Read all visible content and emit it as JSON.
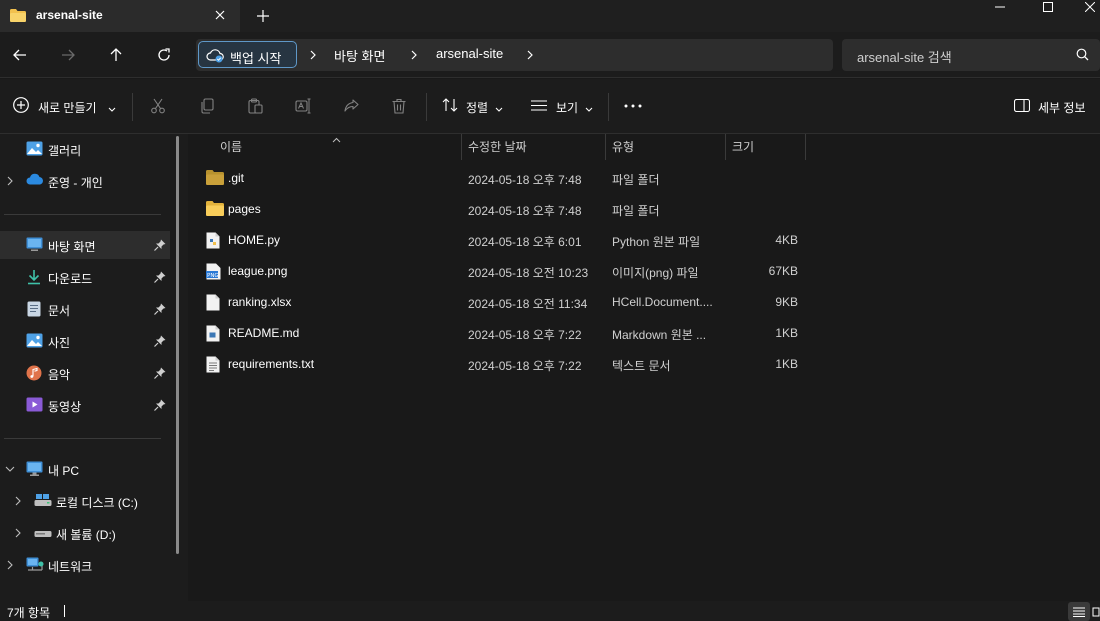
{
  "tab": {
    "title": "arsenal-site"
  },
  "address": {
    "backup_label": "백업 시작",
    "crumbs": [
      "바탕 화면",
      "arsenal-site"
    ]
  },
  "search": {
    "placeholder": "arsenal-site 검색"
  },
  "commands": {
    "new_label": "새로 만들기",
    "sort_label": "정렬",
    "view_label": "보기",
    "details_label": "세부 정보"
  },
  "sidebar": {
    "items": [
      {
        "label": "갤러리",
        "icon": "gallery-icon"
      },
      {
        "label": "준영 - 개인",
        "icon": "onedrive-cloud-icon"
      },
      {
        "label": "바탕 화면",
        "icon": "desktop-icon"
      },
      {
        "label": "다운로드",
        "icon": "download-icon"
      },
      {
        "label": "문서",
        "icon": "document-icon"
      },
      {
        "label": "사진",
        "icon": "pictures-icon"
      },
      {
        "label": "음악",
        "icon": "music-icon"
      },
      {
        "label": "동영상",
        "icon": "video-icon"
      },
      {
        "label": "내 PC",
        "icon": "pc-icon"
      },
      {
        "label": "로컬 디스크 (C:)",
        "icon": "drive-icon"
      },
      {
        "label": "새 볼륨 (D:)",
        "icon": "drive-icon"
      },
      {
        "label": "네트워크",
        "icon": "network-icon"
      }
    ]
  },
  "columns": {
    "name": "이름",
    "date": "수정한 날짜",
    "type": "유형",
    "size": "크기"
  },
  "files": [
    {
      "name": ".git",
      "date": "2024-05-18 오후 7:48",
      "type": "파일 폴더",
      "size": "",
      "icon": "folder-icon"
    },
    {
      "name": "pages",
      "date": "2024-05-18 오후 7:48",
      "type": "파일 폴더",
      "size": "",
      "icon": "folder-icon"
    },
    {
      "name": "HOME.py",
      "date": "2024-05-18 오후 6:01",
      "type": "Python 원본 파일",
      "size": "4KB",
      "icon": "python-file-icon"
    },
    {
      "name": "league.png",
      "date": "2024-05-18 오전 10:23",
      "type": "이미지(png) 파일",
      "size": "67KB",
      "icon": "image-file-icon"
    },
    {
      "name": "ranking.xlsx",
      "date": "2024-05-18 오전 11:34",
      "type": "HCell.Document....",
      "size": "9KB",
      "icon": "file-icon"
    },
    {
      "name": "README.md",
      "date": "2024-05-18 오후 7:22",
      "type": "Markdown 원본 ...",
      "size": "1KB",
      "icon": "markdown-file-icon"
    },
    {
      "name": "requirements.txt",
      "date": "2024-05-18 오후 7:22",
      "type": "텍스트 문서",
      "size": "1KB",
      "icon": "text-file-icon"
    }
  ],
  "status": {
    "count": "7개 항목"
  },
  "colors": {
    "accent": "#4ea1e6",
    "folder": "#f2c14e",
    "background": "#191919"
  }
}
